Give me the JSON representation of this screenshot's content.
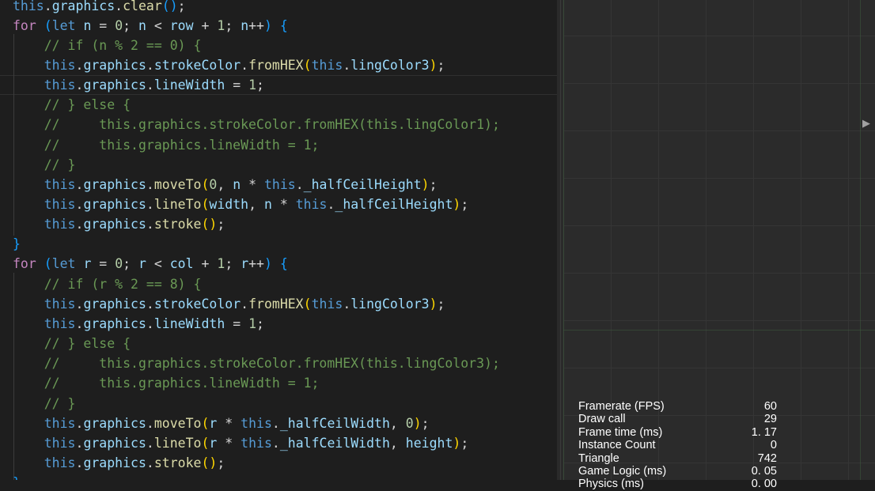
{
  "editor": {
    "lines": [
      [
        [
          "this",
          "kw"
        ],
        [
          ".",
          "pun"
        ],
        [
          "graphics",
          "var"
        ],
        [
          ".",
          "pun"
        ],
        [
          "clear",
          "fn"
        ],
        [
          "()",
          "br3"
        ],
        [
          ";",
          "pun"
        ]
      ],
      [
        [
          "for",
          "ctl"
        ],
        [
          " ",
          "pun"
        ],
        [
          "(",
          "br3"
        ],
        [
          "let",
          "kw"
        ],
        [
          " ",
          "pun"
        ],
        [
          "n",
          "var"
        ],
        [
          " = ",
          "pun"
        ],
        [
          "0",
          "num"
        ],
        [
          "; ",
          "pun"
        ],
        [
          "n",
          "var"
        ],
        [
          " < ",
          "pun"
        ],
        [
          "row",
          "var"
        ],
        [
          " + ",
          "pun"
        ],
        [
          "1",
          "num"
        ],
        [
          "; ",
          "pun"
        ],
        [
          "n",
          "var"
        ],
        [
          "++",
          "pun"
        ],
        [
          ")",
          "br3"
        ],
        [
          " ",
          "pun"
        ],
        [
          "{",
          "br3"
        ]
      ],
      [
        [
          "    ",
          "pun"
        ],
        [
          "// if (n % 2 == 0) {",
          "cmt"
        ]
      ],
      [
        [
          "    ",
          "pun"
        ],
        [
          "this",
          "kw"
        ],
        [
          ".",
          "pun"
        ],
        [
          "graphics",
          "var"
        ],
        [
          ".",
          "pun"
        ],
        [
          "strokeColor",
          "var"
        ],
        [
          ".",
          "pun"
        ],
        [
          "fromHEX",
          "fn"
        ],
        [
          "(",
          "br1"
        ],
        [
          "this",
          "kw"
        ],
        [
          ".",
          "pun"
        ],
        [
          "lingColor3",
          "var"
        ],
        [
          ")",
          "br1"
        ],
        [
          ";",
          "pun"
        ]
      ],
      [
        [
          "    ",
          "pun"
        ],
        [
          "this",
          "kw"
        ],
        [
          ".",
          "pun"
        ],
        [
          "graphics",
          "var"
        ],
        [
          ".",
          "pun"
        ],
        [
          "lineWidth",
          "var"
        ],
        [
          " = ",
          "pun"
        ],
        [
          "1",
          "num"
        ],
        [
          ";",
          "pun"
        ]
      ],
      [
        [
          "    ",
          "pun"
        ],
        [
          "// } else {",
          "cmt"
        ]
      ],
      [
        [
          "    ",
          "pun"
        ],
        [
          "//     this.graphics.strokeColor.fromHEX(this.lingColor1);",
          "cmt"
        ]
      ],
      [
        [
          "    ",
          "pun"
        ],
        [
          "//     this.graphics.lineWidth = 1;",
          "cmt"
        ]
      ],
      [
        [
          "    ",
          "pun"
        ],
        [
          "// }",
          "cmt"
        ]
      ],
      [
        [
          "    ",
          "pun"
        ],
        [
          "this",
          "kw"
        ],
        [
          ".",
          "pun"
        ],
        [
          "graphics",
          "var"
        ],
        [
          ".",
          "pun"
        ],
        [
          "moveTo",
          "fn"
        ],
        [
          "(",
          "br1"
        ],
        [
          "0",
          "num"
        ],
        [
          ", ",
          "pun"
        ],
        [
          "n",
          "var"
        ],
        [
          " * ",
          "pun"
        ],
        [
          "this",
          "kw"
        ],
        [
          ".",
          "pun"
        ],
        [
          "_halfCeilHeight",
          "var"
        ],
        [
          ")",
          "br1"
        ],
        [
          ";",
          "pun"
        ]
      ],
      [
        [
          "    ",
          "pun"
        ],
        [
          "this",
          "kw"
        ],
        [
          ".",
          "pun"
        ],
        [
          "graphics",
          "var"
        ],
        [
          ".",
          "pun"
        ],
        [
          "lineTo",
          "fn"
        ],
        [
          "(",
          "br1"
        ],
        [
          "width",
          "var"
        ],
        [
          ", ",
          "pun"
        ],
        [
          "n",
          "var"
        ],
        [
          " * ",
          "pun"
        ],
        [
          "this",
          "kw"
        ],
        [
          ".",
          "pun"
        ],
        [
          "_halfCeilHeight",
          "var"
        ],
        [
          ")",
          "br1"
        ],
        [
          ";",
          "pun"
        ]
      ],
      [
        [
          "    ",
          "pun"
        ],
        [
          "this",
          "kw"
        ],
        [
          ".",
          "pun"
        ],
        [
          "graphics",
          "var"
        ],
        [
          ".",
          "pun"
        ],
        [
          "stroke",
          "fn"
        ],
        [
          "()",
          "br1"
        ],
        [
          ";",
          "pun"
        ]
      ],
      [
        [
          "}",
          "br3"
        ]
      ],
      [
        [
          "for",
          "ctl"
        ],
        [
          " ",
          "pun"
        ],
        [
          "(",
          "br3"
        ],
        [
          "let",
          "kw"
        ],
        [
          " ",
          "pun"
        ],
        [
          "r",
          "var"
        ],
        [
          " = ",
          "pun"
        ],
        [
          "0",
          "num"
        ],
        [
          "; ",
          "pun"
        ],
        [
          "r",
          "var"
        ],
        [
          " < ",
          "pun"
        ],
        [
          "col",
          "var"
        ],
        [
          " + ",
          "pun"
        ],
        [
          "1",
          "num"
        ],
        [
          "; ",
          "pun"
        ],
        [
          "r",
          "var"
        ],
        [
          "++",
          "pun"
        ],
        [
          ")",
          "br3"
        ],
        [
          " ",
          "pun"
        ],
        [
          "{",
          "br3"
        ]
      ],
      [
        [
          "    ",
          "pun"
        ],
        [
          "// if (r % 2 == 8) {",
          "cmt"
        ]
      ],
      [
        [
          "    ",
          "pun"
        ],
        [
          "this",
          "kw"
        ],
        [
          ".",
          "pun"
        ],
        [
          "graphics",
          "var"
        ],
        [
          ".",
          "pun"
        ],
        [
          "strokeColor",
          "var"
        ],
        [
          ".",
          "pun"
        ],
        [
          "fromHEX",
          "fn"
        ],
        [
          "(",
          "br1"
        ],
        [
          "this",
          "kw"
        ],
        [
          ".",
          "pun"
        ],
        [
          "lingColor3",
          "var"
        ],
        [
          ")",
          "br1"
        ],
        [
          ";",
          "pun"
        ]
      ],
      [
        [
          "    ",
          "pun"
        ],
        [
          "this",
          "kw"
        ],
        [
          ".",
          "pun"
        ],
        [
          "graphics",
          "var"
        ],
        [
          ".",
          "pun"
        ],
        [
          "lineWidth",
          "var"
        ],
        [
          " = ",
          "pun"
        ],
        [
          "1",
          "num"
        ],
        [
          ";",
          "pun"
        ]
      ],
      [
        [
          "    ",
          "pun"
        ],
        [
          "// } else {",
          "cmt"
        ]
      ],
      [
        [
          "    ",
          "pun"
        ],
        [
          "//     this.graphics.strokeColor.fromHEX(this.lingColor3);",
          "cmt"
        ]
      ],
      [
        [
          "    ",
          "pun"
        ],
        [
          "//     this.graphics.lineWidth = 1;",
          "cmt"
        ]
      ],
      [
        [
          "    ",
          "pun"
        ],
        [
          "// }",
          "cmt"
        ]
      ],
      [
        [
          "    ",
          "pun"
        ],
        [
          "this",
          "kw"
        ],
        [
          ".",
          "pun"
        ],
        [
          "graphics",
          "var"
        ],
        [
          ".",
          "pun"
        ],
        [
          "moveTo",
          "fn"
        ],
        [
          "(",
          "br1"
        ],
        [
          "r",
          "var"
        ],
        [
          " * ",
          "pun"
        ],
        [
          "this",
          "kw"
        ],
        [
          ".",
          "pun"
        ],
        [
          "_halfCeilWidth",
          "var"
        ],
        [
          ", ",
          "pun"
        ],
        [
          "0",
          "num"
        ],
        [
          ")",
          "br1"
        ],
        [
          ";",
          "pun"
        ]
      ],
      [
        [
          "    ",
          "pun"
        ],
        [
          "this",
          "kw"
        ],
        [
          ".",
          "pun"
        ],
        [
          "graphics",
          "var"
        ],
        [
          ".",
          "pun"
        ],
        [
          "lineTo",
          "fn"
        ],
        [
          "(",
          "br1"
        ],
        [
          "r",
          "var"
        ],
        [
          " * ",
          "pun"
        ],
        [
          "this",
          "kw"
        ],
        [
          ".",
          "pun"
        ],
        [
          "_halfCeilWidth",
          "var"
        ],
        [
          ", ",
          "pun"
        ],
        [
          "height",
          "var"
        ],
        [
          ")",
          "br1"
        ],
        [
          ";",
          "pun"
        ]
      ],
      [
        [
          "    ",
          "pun"
        ],
        [
          "this",
          "kw"
        ],
        [
          ".",
          "pun"
        ],
        [
          "graphics",
          "var"
        ],
        [
          ".",
          "pun"
        ],
        [
          "stroke",
          "fn"
        ],
        [
          "()",
          "br1"
        ],
        [
          ";",
          "pun"
        ]
      ],
      [
        [
          "}",
          "br3"
        ]
      ]
    ]
  },
  "scene": {
    "expand_arrow": "▶",
    "stats": [
      {
        "label": "Framerate (FPS)",
        "value": "60"
      },
      {
        "label": "Draw call",
        "value": "29"
      },
      {
        "label": "Frame time (ms)",
        "value": "1. 17"
      },
      {
        "label": "Instance Count",
        "value": "0"
      },
      {
        "label": "Triangle",
        "value": "742"
      },
      {
        "label": "Game Logic (ms)",
        "value": "0. 05"
      },
      {
        "label": "Physics (ms)",
        "value": "0. 00"
      }
    ]
  },
  "colors": {
    "background": "#1e1e1e",
    "keyword": "#569cd6",
    "control": "#c586c0",
    "variable": "#9cdcfe",
    "function": "#dcdcaa",
    "number": "#b5cea8",
    "comment": "#6a9955",
    "bracket_yellow": "#ffd700",
    "bracket_blue": "#179fff",
    "scene_bg": "#2b2b2b"
  }
}
